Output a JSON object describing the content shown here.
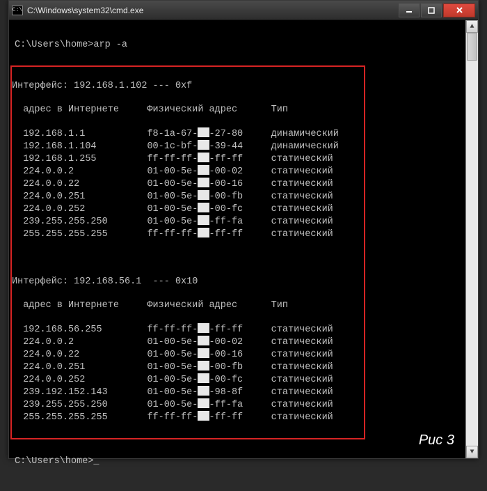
{
  "window": {
    "title": "C:\\Windows\\system32\\cmd.exe",
    "icon_label": "C:\\"
  },
  "terminal": {
    "prompt1": "C:\\Users\\home>",
    "command": "arp -a",
    "prompt2": "C:\\Users\\home>",
    "cursor": "_",
    "headers": {
      "iface_prefix": "Интерфейс: ",
      "col_addr": "адрес в Интернете",
      "col_phys": "Физический адрес",
      "col_type": "Тип"
    },
    "iface1": {
      "header": "192.168.1.102 --- 0xf",
      "rows": [
        {
          "ip": "192.168.1.1",
          "mac_a": "f8-1a-67-",
          "mac_b": "-27-80",
          "type": "динамический"
        },
        {
          "ip": "192.168.1.104",
          "mac_a": "00-1c-bf-",
          "mac_b": "-39-44",
          "type": "динамический"
        },
        {
          "ip": "192.168.1.255",
          "mac_a": "ff-ff-ff-",
          "mac_b": "-ff-ff",
          "type": "статический"
        },
        {
          "ip": "224.0.0.2",
          "mac_a": "01-00-5e-",
          "mac_b": "-00-02",
          "type": "статический"
        },
        {
          "ip": "224.0.0.22",
          "mac_a": "01-00-5e-",
          "mac_b": "-00-16",
          "type": "статический"
        },
        {
          "ip": "224.0.0.251",
          "mac_a": "01-00-5e-",
          "mac_b": "-00-fb",
          "type": "статический"
        },
        {
          "ip": "224.0.0.252",
          "mac_a": "01-00-5e-",
          "mac_b": "-00-fc",
          "type": "статический"
        },
        {
          "ip": "239.255.255.250",
          "mac_a": "01-00-5e-",
          "mac_b": "-ff-fa",
          "type": "статический"
        },
        {
          "ip": "255.255.255.255",
          "mac_a": "ff-ff-ff-",
          "mac_b": "-ff-ff",
          "type": "статический"
        }
      ]
    },
    "iface2": {
      "header": "192.168.56.1  --- 0x10",
      "rows": [
        {
          "ip": "192.168.56.255",
          "mac_a": "ff-ff-ff-",
          "mac_b": "-ff-ff",
          "type": "статический"
        },
        {
          "ip": "224.0.0.2",
          "mac_a": "01-00-5e-",
          "mac_b": "-00-02",
          "type": "статический"
        },
        {
          "ip": "224.0.0.22",
          "mac_a": "01-00-5e-",
          "mac_b": "-00-16",
          "type": "статический"
        },
        {
          "ip": "224.0.0.251",
          "mac_a": "01-00-5e-",
          "mac_b": "-00-fb",
          "type": "статический"
        },
        {
          "ip": "224.0.0.252",
          "mac_a": "01-00-5e-",
          "mac_b": "-00-fc",
          "type": "статический"
        },
        {
          "ip": "239.192.152.143",
          "mac_a": "01-00-5e-",
          "mac_b": "-98-8f",
          "type": "статический"
        },
        {
          "ip": "239.255.255.250",
          "mac_a": "01-00-5e-",
          "mac_b": "-ff-fa",
          "type": "статический"
        },
        {
          "ip": "255.255.255.255",
          "mac_a": "ff-ff-ff-",
          "mac_b": "-ff-ff",
          "type": "статический"
        }
      ]
    }
  },
  "figure_label": "Рис 3"
}
